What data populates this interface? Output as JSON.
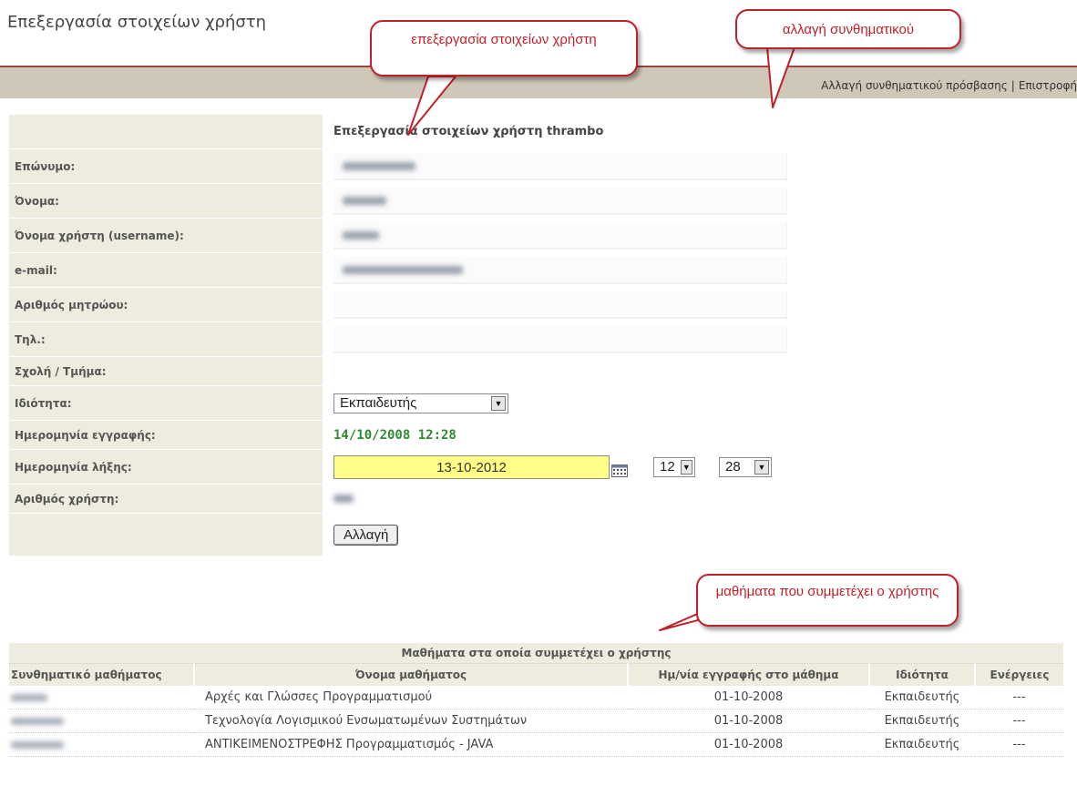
{
  "page": {
    "title": "Επεξεργασία στοιχείων χρήστη"
  },
  "nav": {
    "change_password": "Αλλαγή συνθηματικού πρόσβασης",
    "separator": "|",
    "back": "Επιστροφή"
  },
  "form": {
    "heading": "Επεξεργασία στοιχείων χρήστη thrambo",
    "labels": {
      "surname": "Επώνυμο:",
      "name": "Όνομα:",
      "username": "Όνομα χρήστη (username):",
      "email": "e-mail:",
      "registry_number": "Αριθμός μητρώου:",
      "phone": "Τηλ.:",
      "school": "Σχολή / Τμήμα:",
      "role": "Ιδιότητα:",
      "registration_date": "Ημερομηνία εγγραφής:",
      "expiry_date": "Ημερομηνία λήξης:",
      "user_number": "Αριθμός χρήστη:"
    },
    "role_value": "Εκπαιδευτής",
    "registration_date": "14/10/2008 12:28",
    "expiry_date": "13-10-2012",
    "expiry_hour": "12",
    "expiry_minute": "28",
    "submit_label": "Αλλαγή"
  },
  "courses": {
    "caption": "Μαθήματα στα οποία συμμετέχει ο χρήστης",
    "headers": [
      "Συνθηματικό μαθήματος",
      "Όνομα μαθήματος",
      "Ημ/νία εγγραφής στο μάθημα",
      "Ιδιότητα",
      "Ενέργειες"
    ],
    "rows": [
      {
        "name": "Αρχές και Γλώσσες Προγραμματισμού",
        "date": "01-10-2008",
        "role": "Εκπαιδευτής",
        "actions": "---"
      },
      {
        "name": "Τεχνολογία Λογισμικού Ενσωματωμένων Συστημάτων",
        "date": "01-10-2008",
        "role": "Εκπαιδευτής",
        "actions": "---"
      },
      {
        "name": "ΑΝΤΙΚΕΙΜΕΝΟΣΤΡΕΦΗΣ Προγραμματισμός - JAVA",
        "date": "01-10-2008",
        "role": "Εκπαιδευτής",
        "actions": "---"
      }
    ]
  },
  "callouts": {
    "edit_details": "επεξεργασία στοιχείων χρήστη",
    "change_password": "αλλαγή συνθηματικού",
    "courses": "μαθήματα που συμμετέχει ο χρήστης"
  },
  "colors": {
    "accent_red": "#c0202a",
    "label_bg": "#eeecde",
    "nav_bg": "#cfc8b8",
    "date_highlight": "#ffff88",
    "reg_date_green": "#2e8b2e"
  }
}
